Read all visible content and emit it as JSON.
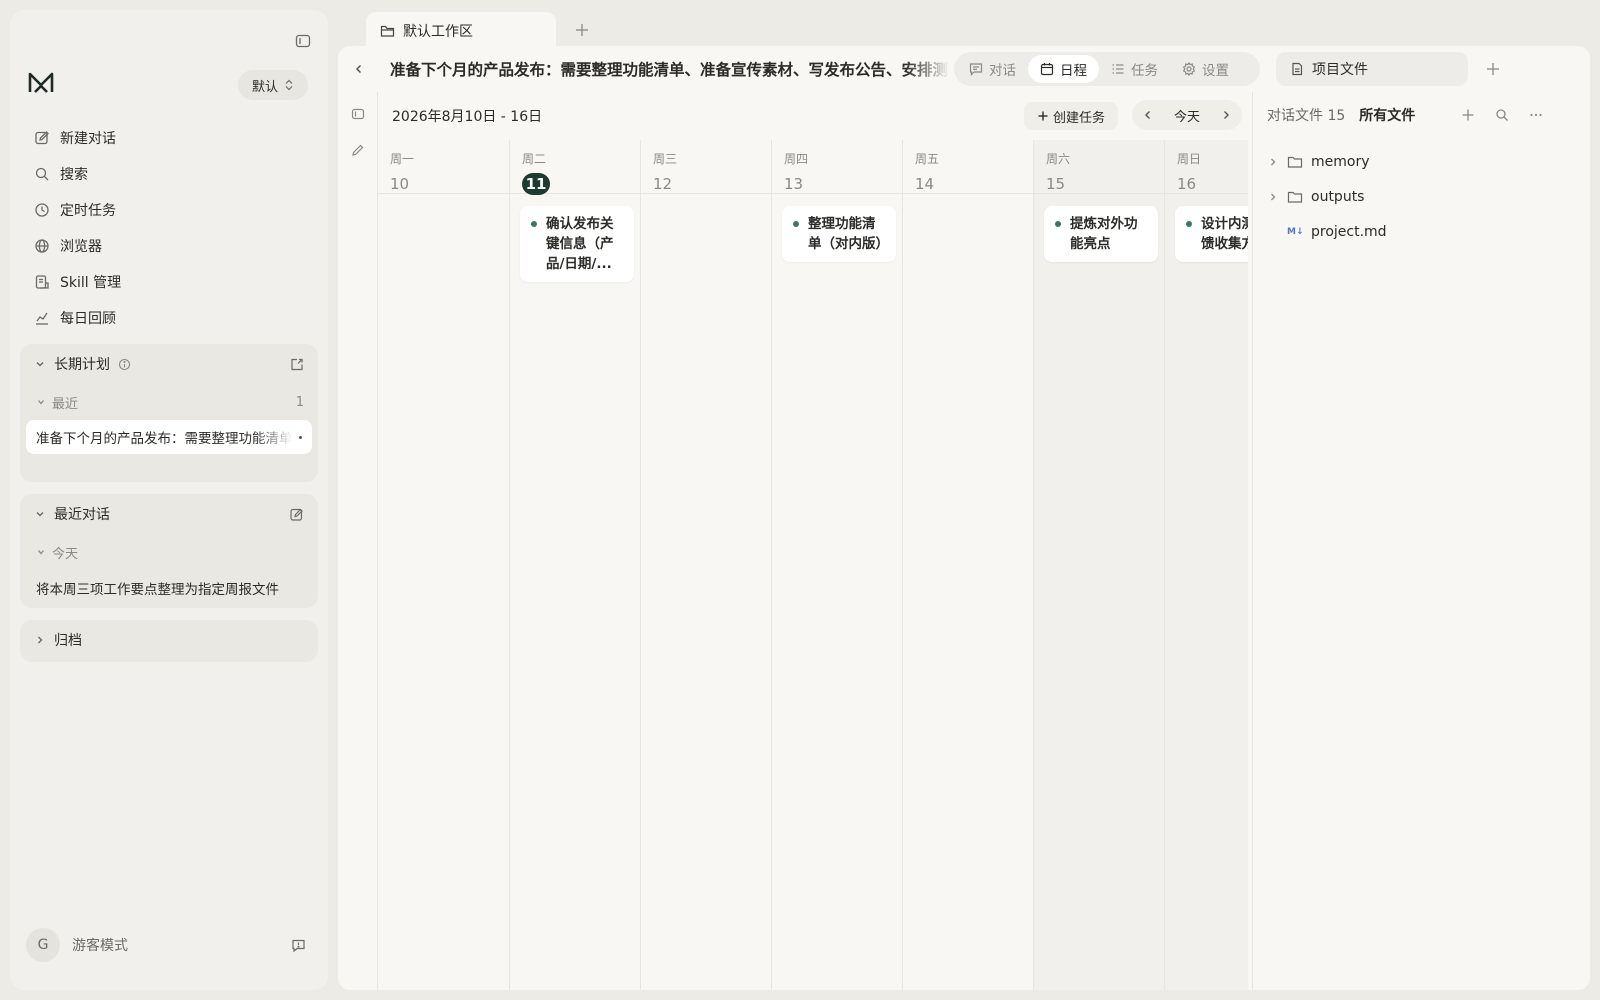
{
  "sidebar": {
    "workspace_select": "默认",
    "nav": [
      {
        "label": "新建对话",
        "icon": "edit-icon"
      },
      {
        "label": "搜索",
        "icon": "search-icon"
      },
      {
        "label": "定时任务",
        "icon": "clock-icon"
      },
      {
        "label": "浏览器",
        "icon": "globe-icon"
      },
      {
        "label": "Skill 管理",
        "icon": "skill-icon"
      },
      {
        "label": "每日回顾",
        "icon": "chart-icon"
      }
    ],
    "long_plan": {
      "title": "长期计划",
      "recent_label": "最近",
      "recent_count": "1",
      "items": [
        "准备下个月的产品发布：需要整理功能清单、准备宣传素材、写发布公告、"
      ]
    },
    "recent_conversations": {
      "title": "最近对话",
      "today_label": "今天",
      "items": [
        "将本周三项工作要点整理为指定周报文件"
      ]
    },
    "archive": {
      "title": "归档"
    },
    "user": {
      "avatar_letter": "G",
      "name": "游客模式"
    }
  },
  "tabs": {
    "workspace_tab": "默认工作区"
  },
  "topbar": {
    "title": "准备下个月的产品发布：需要整理功能清单、准备宣传素材、写发布公告、安排测试",
    "segments": [
      {
        "label": "对话",
        "icon": "chat-icon",
        "active": false
      },
      {
        "label": "日程",
        "icon": "calendar-icon",
        "active": true
      },
      {
        "label": "任务",
        "icon": "task-list-icon",
        "active": false
      },
      {
        "label": "设置",
        "icon": "gear-icon",
        "active": false
      }
    ],
    "files_tab": "项目文件"
  },
  "calendar": {
    "range": "2026年8月10日 - 16日",
    "create_task": "创建任务",
    "today": "今天",
    "days": [
      {
        "dow": "周一",
        "num": "10",
        "today": false,
        "weekend": false,
        "event": ""
      },
      {
        "dow": "周二",
        "num": "11",
        "today": true,
        "weekend": false,
        "event": "确认发布关键信息（产品/日期/..."
      },
      {
        "dow": "周三",
        "num": "12",
        "today": false,
        "weekend": false,
        "event": ""
      },
      {
        "dow": "周四",
        "num": "13",
        "today": false,
        "weekend": false,
        "event": "整理功能清单（对内版）"
      },
      {
        "dow": "周五",
        "num": "14",
        "today": false,
        "weekend": false,
        "event": ""
      },
      {
        "dow": "周六",
        "num": "15",
        "today": false,
        "weekend": true,
        "event": "提炼对外功能亮点"
      },
      {
        "dow": "周日",
        "num": "16",
        "today": false,
        "weekend": true,
        "event": "设计内测反馈收集方"
      }
    ]
  },
  "files": {
    "conv_files_label": "对话文件 15",
    "all_files_label": "所有文件",
    "tree": [
      {
        "name": "memory",
        "type": "folder"
      },
      {
        "name": "outputs",
        "type": "folder"
      },
      {
        "name": "project.md",
        "type": "file",
        "badge": "M↓"
      }
    ]
  },
  "colors": {
    "accent_dark": "#1f3a30",
    "event_dot": "#3a7a5a"
  }
}
